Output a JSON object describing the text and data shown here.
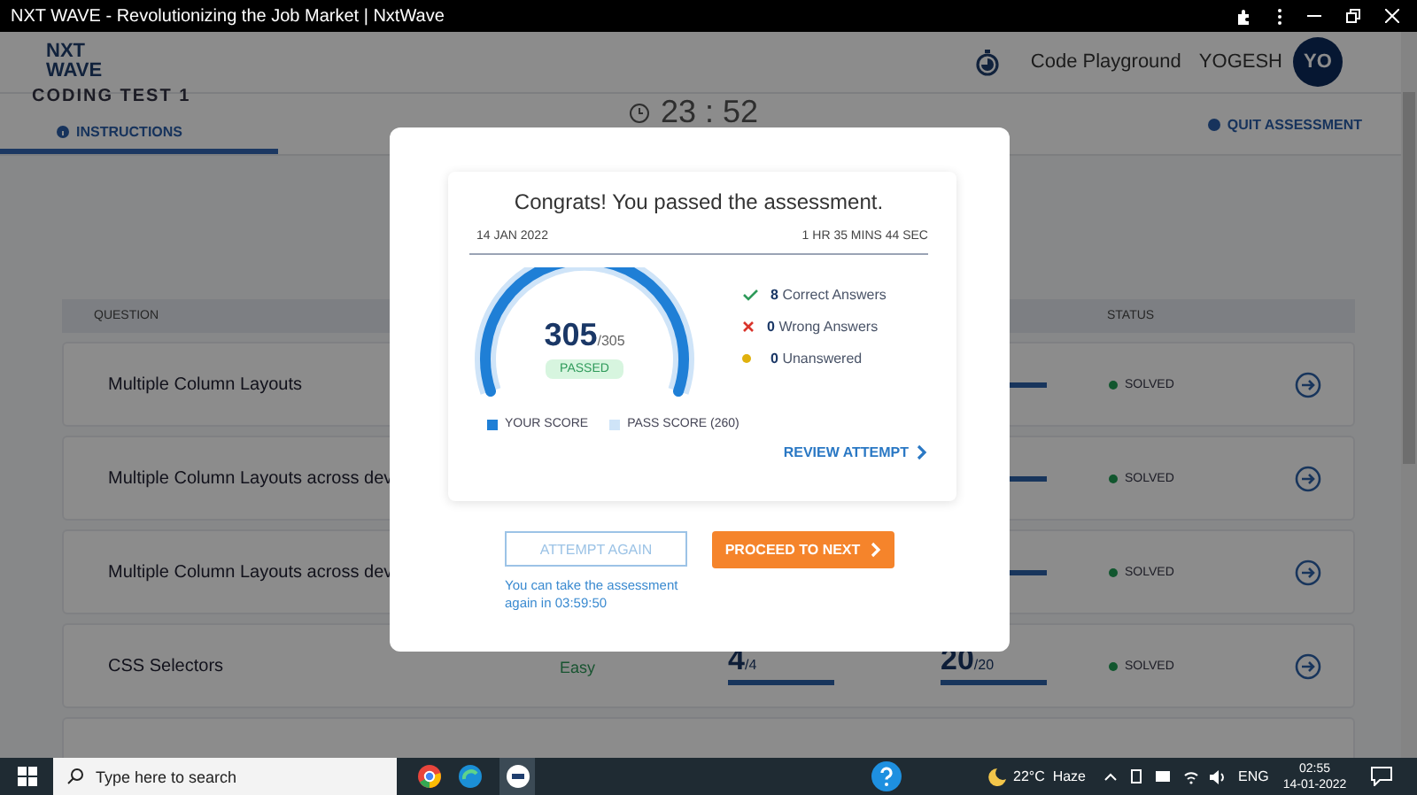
{
  "browser": {
    "title": "NXT WAVE - Revolutionizing the Job Market | NxtWave"
  },
  "header": {
    "logo": [
      "NXT",
      "WAVE"
    ],
    "playground": "Code Playground",
    "user": "YOGESH",
    "avatar": "YO"
  },
  "subheader": {
    "test_title": "CODING TEST 1",
    "tabs": [
      {
        "label": "INSTRUCTIONS",
        "selected": true
      }
    ],
    "timer": "23 : 52",
    "quit": "QUIT ASSESSMENT"
  },
  "table": {
    "columns": [
      "QUESTION",
      "STATUS"
    ],
    "rows": [
      {
        "name": "Multiple Column Layouts",
        "status": "SOLVED"
      },
      {
        "name": "Multiple Column Layouts across dev",
        "status": "SOLVED"
      },
      {
        "name": "Multiple Column Layouts across dev",
        "status": "SOLVED"
      },
      {
        "name": "CSS Selectors",
        "difficulty": "Easy",
        "scores": [
          [
            "4",
            "/4"
          ],
          [
            "20",
            "/20"
          ]
        ],
        "status": "SOLVED"
      }
    ]
  },
  "modal": {
    "title": "Congrats! You passed the assessment.",
    "date": "14 JAN 2022",
    "duration": "1 HR 35 MINS 44 SEC",
    "score": "305",
    "total": "/305",
    "result": "PASSED",
    "stats": [
      {
        "kind": "correct",
        "count": "8",
        "label": "Correct Answers"
      },
      {
        "kind": "wrong",
        "count": "0",
        "label": "Wrong Answers"
      },
      {
        "kind": "unanswered",
        "count": "0",
        "label": "Unanswered"
      }
    ],
    "legend": [
      "YOUR SCORE",
      "PASS SCORE (260)"
    ],
    "review": "REVIEW ATTEMPT",
    "attempt_again": {
      "label": "ATTEMPT AGAIN",
      "disabled": true
    },
    "proceed": "PROCEED TO NEXT",
    "note": "You can take the assessment again in 03:59:50"
  },
  "taskbar": {
    "search_placeholder": "Type here to search",
    "weather": "22°C  Haze",
    "language": "ENG",
    "time": "02:55",
    "date": "14-01-2022"
  }
}
